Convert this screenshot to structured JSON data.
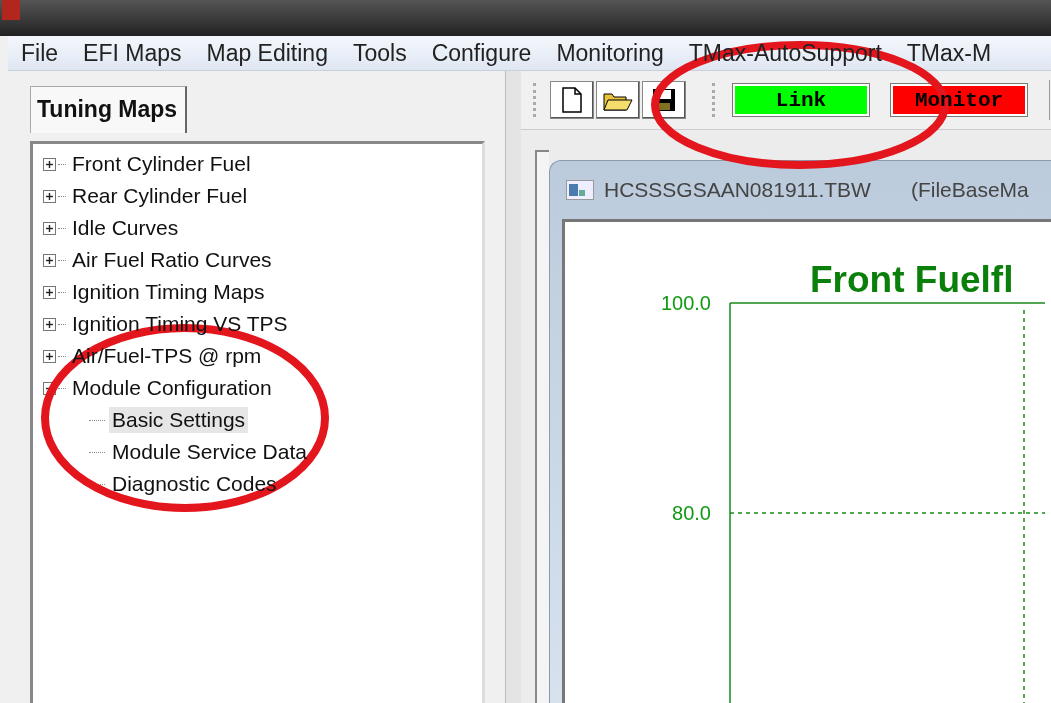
{
  "menu": [
    "File",
    "EFI Maps",
    "Map Editing",
    "Tools",
    "Configure",
    "Monitoring",
    "TMax-AutoSupport",
    "TMax-M"
  ],
  "tree_panel": {
    "tab": {
      "label": "Tuning Maps",
      "selected": true
    },
    "items": [
      {
        "label": "Front Cylinder Fuel",
        "expanded": false,
        "selected": false
      },
      {
        "label": "Rear Cylinder Fuel",
        "expanded": false,
        "selected": false
      },
      {
        "label": "Idle Curves",
        "expanded": false,
        "selected": false
      },
      {
        "label": "Air Fuel Ratio Curves",
        "expanded": false,
        "selected": false
      },
      {
        "label": "Ignition Timing Maps",
        "expanded": false,
        "selected": false
      },
      {
        "label": "Ignition Timing VS TPS",
        "expanded": false,
        "selected": false
      },
      {
        "label": "Air/Fuel-TPS @ rpm",
        "expanded": false,
        "selected": false
      },
      {
        "label": "Module Configuration",
        "expanded": true,
        "selected": false,
        "children": [
          {
            "label": "Basic Settings",
            "selected": true
          },
          {
            "label": "Module Service Data",
            "selected": false
          },
          {
            "label": "Diagnostic Codes",
            "selected": false
          }
        ]
      }
    ]
  },
  "toolbar": {
    "status_buttons": [
      {
        "label": "Link",
        "color": "#00ff00"
      },
      {
        "label": "Monitor",
        "color": "#ff0000"
      }
    ]
  },
  "map_window": {
    "title": "HCSSSGSAAN081911.TBW",
    "subtitle": "(FileBaseMa",
    "chart": {
      "title": "Front Fuelfl",
      "y_ticks": [
        "100.0",
        "80.0"
      ]
    }
  },
  "annotations": [
    {
      "kind": "circle"
    },
    {
      "kind": "circle"
    }
  ]
}
